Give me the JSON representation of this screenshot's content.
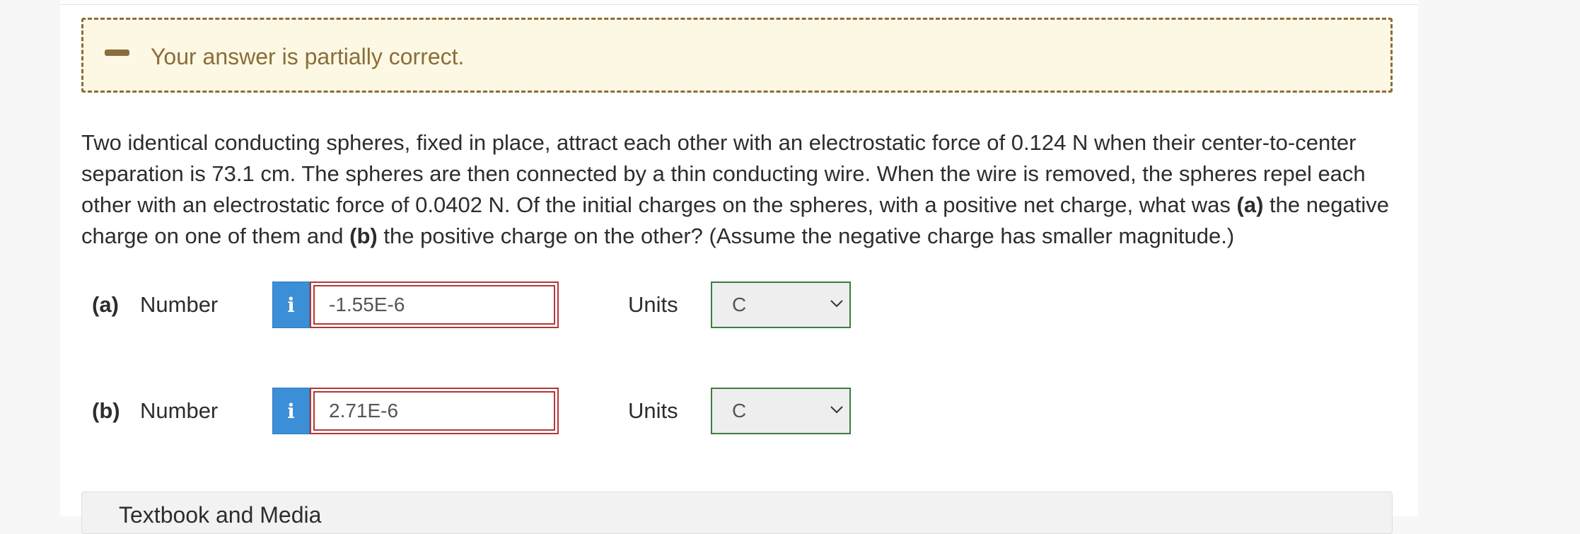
{
  "feedback": {
    "message": "Your answer is partially correct.",
    "icon": "minus-icon",
    "color": "#8a6d3b",
    "background": "#fcf8e3"
  },
  "question": {
    "text_1": "Two identical conducting spheres, fixed in place, attract each other with an electrostatic force of 0.124 N when their center-to-center separation is 73.1 cm. The spheres are then connected by a thin conducting wire. When the wire is removed, the spheres repel each other with an electrostatic force of 0.0402 N. Of the initial charges on the spheres, with a positive net charge, what was ",
    "part_a": "(a)",
    "text_2": " the negative charge on one of them and ",
    "part_b": "(b)",
    "text_3": " the positive charge on the other? (Assume the negative charge has smaller magnitude.)"
  },
  "answers": [
    {
      "part": "(a)",
      "number_label": "Number",
      "info_icon": "i",
      "value": "-1.55E-6",
      "units_label": "Units",
      "unit": "C"
    },
    {
      "part": "(b)",
      "number_label": "Number",
      "info_icon": "i",
      "value": "2.71E-6",
      "units_label": "Units",
      "unit": "C"
    }
  ],
  "bottom_panel": {
    "label": "Textbook and Media"
  }
}
